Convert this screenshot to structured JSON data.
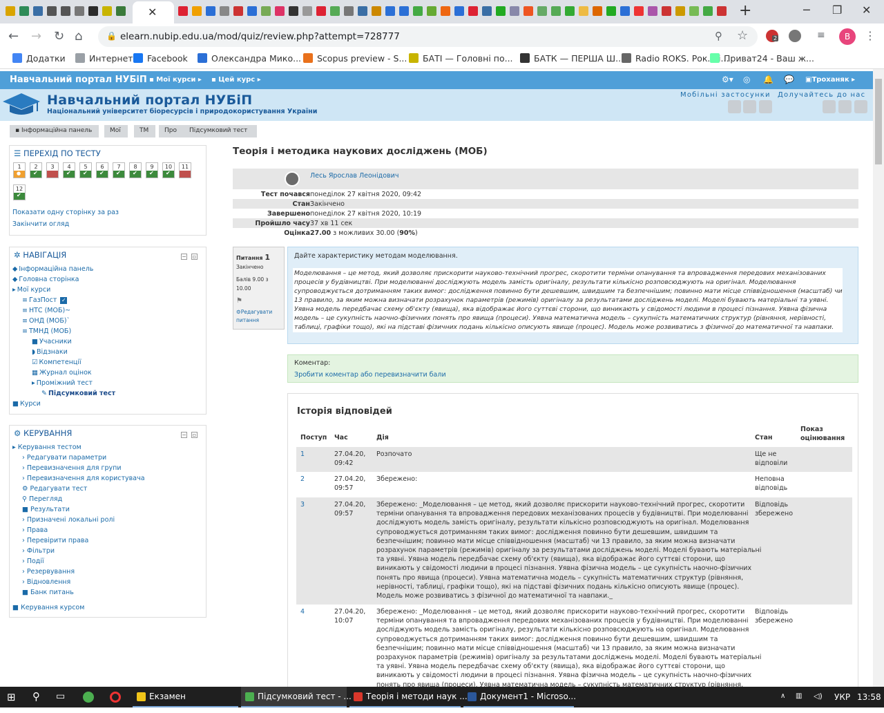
{
  "browser": {
    "url": "elearn.nubip.edu.ua/mod/quiz/review.php?attempt=728777",
    "bookmarks": [
      "Додатки",
      "Интернет",
      "Facebook",
      "Олександра Мико...",
      "Scopus preview - S...",
      "БАТІ — Головні по...",
      "БАТК — ПЕРША Ш...",
      "Radio ROKS. Рок. Ті...",
      "Приват24 - Ваш ж..."
    ],
    "profile_initial": "B",
    "badge": "2"
  },
  "site": {
    "brand": "Навчальний портал НУБіП",
    "my_courses": "Мої курси",
    "this_course": "Цей курс",
    "user": "Троханяк",
    "title": "Навчальний портал НУБіП",
    "subtitle": "Національний університет біоресурсів і природокористування України",
    "mobile_apps": "Мобільні застосунки",
    "join_us": "Долучайтесь до нас"
  },
  "breadcrumb": [
    "Інформаційна панель",
    "Мої",
    "ТМ",
    "Про",
    "Підсумковий тест"
  ],
  "quiz_nav": {
    "title": "ПЕРЕХІД ПО ТЕСТУ",
    "questions": [
      {
        "n": "1",
        "state": "flag"
      },
      {
        "n": "2",
        "state": "ok"
      },
      {
        "n": "3",
        "state": "bad"
      },
      {
        "n": "4",
        "state": "ok"
      },
      {
        "n": "5",
        "state": "ok"
      },
      {
        "n": "6",
        "state": "ok"
      },
      {
        "n": "7",
        "state": "ok"
      },
      {
        "n": "8",
        "state": "ok"
      },
      {
        "n": "9",
        "state": "ok"
      },
      {
        "n": "10",
        "state": "ok"
      },
      {
        "n": "11",
        "state": "bad"
      },
      {
        "n": "12",
        "state": "ok"
      }
    ],
    "show_one_page": "Показати одну сторінку за раз",
    "finish_review": "Закінчити огляд"
  },
  "navigation": {
    "title": "НАВІГАЦІЯ",
    "items": [
      "Інформаційна панель",
      "Головна сторінка",
      "Мої курси",
      "ГазПост",
      "НТС (МОБ)~",
      "ОНД (МОБ)`",
      "ТМНД (МОБ)",
      "Учасники",
      "Відзнаки",
      "Компетенції",
      "Журнал оцінок",
      "Проміжний тест",
      "Підсумковий тест",
      "Курси"
    ]
  },
  "admin": {
    "title": "КЕРУВАННЯ",
    "items": [
      "Керування тестом",
      "Редагувати параметри",
      "Перевизначення для групи",
      "Перевизначення для користувача",
      "Редагувати тест",
      "Перегляд",
      "Результати",
      "Призначені локальні ролі",
      "Права",
      "Перевірити права",
      "Фільтри",
      "Події",
      "Резервування",
      "Відновлення",
      "Банк питань",
      "Керування курсом"
    ]
  },
  "quiz": {
    "title": "Теорія і методика наукових досліджень (МОБ)",
    "student": "Лесь Ярослав Леонідович",
    "summary": [
      {
        "k": "Тест почався",
        "v": "понеділок 27 квітня 2020, 09:42"
      },
      {
        "k": "Стан",
        "v": "Закінчено"
      },
      {
        "k": "Завершено",
        "v": "понеділок 27 квітня 2020, 10:19"
      },
      {
        "k": "Пройшло часу",
        "v": "37 хв 11 сек"
      },
      {
        "k": "Оцінка",
        "v_bold": "27.00",
        "v_mid": " з можливих 30.00 (",
        "v_pct": "90%",
        "v_end": ")"
      }
    ]
  },
  "question": {
    "label": "Питання",
    "number": "1",
    "state": "Закінчено",
    "marks": "Балів 9.00 з 10.00",
    "edit": "Редагувати питання",
    "prompt": "Дайте характеристику методам моделювання.",
    "answer_lines": [
      "Моделювання – це метод, який дозволяє прискорити науково-технічний прогрес, скоротити терміни опанування та впровадження передових механізованих",
      "процесів у будівництві. При моделюванні досліджують модель замість оригіналу, результати кількісно розповсюджують на оригінал. Моделювання",
      "супроводжується дотриманням таких вимог: дослідження повинно бути дешевшим, швидшим та безпечнішим; повинно мати місце співвідношення (масштаб) чи",
      "13 правило, за яким можна визначати розрахунок параметрів (режимів) оригіналу за результатами досліджень моделі. Моделі бувають матеріальні та уявні.",
      "Уявна модель передбачає схему об'єкту (явища), яка відображає його суттєві сторони, що виникають у свідомості людини в процесі пізнання. Уявна фізична",
      "модель – це сукупність наочно-фізичних понять про явища (процеси). Уявна математична модель – сукупність математичних структур (рівняння, нерівності,",
      "таблиці, графіки тощо), які на підставі фізичних подань кількісно описують явище (процес). Модель може розвиватись з фізичної до математичної та навпаки."
    ],
    "comment_label": "Коментар:",
    "comment_link": "Зробити коментар або перевизначити бали"
  },
  "history": {
    "title": "Історія відповідей",
    "headers": [
      "Поступ",
      "Час",
      "Дія",
      "Стан",
      "Показ оцінювання"
    ],
    "rows": [
      {
        "step": "1",
        "date": "27.04.20,",
        "time": "09:42",
        "action": [
          "Розпочато"
        ],
        "state": [
          "Ще не",
          "відповіли"
        ]
      },
      {
        "step": "2",
        "date": "27.04.20,",
        "time": "09:57",
        "action": [
          "Збережено:"
        ],
        "state": [
          "Неповна",
          "відповідь"
        ]
      },
      {
        "step": "3",
        "date": "27.04.20,",
        "time": "09:57",
        "action": [
          "Збережено: _Моделювання – це метод, який дозволяє прискорити науково-технічний прогрес, скоротити",
          "терміни опанування та впровадження передових механізованих процесів у будівництві. При моделюванні",
          "досліджують модель замість оригіналу, результати кількісно розповсюджують на оригінал. Моделювання",
          "супроводжується дотриманням таких вимог: дослідження повинно бути дешевшим, швидшим та",
          "безпечнішим; повинно мати місце співвідношення (масштаб) чи 13 правило, за яким можна визначати",
          "розрахунок параметрів (режимів) оригіналу за результатами досліджень моделі. Моделі бувають матеріальні",
          "та уявні. Уявна модель передбачає схему об'єкту (явища), яка відображає його суттєві сторони, що",
          "виникають у свідомості людини в процесі пізнання. Уявна фізична модель – це сукупність наочно-фізичних",
          "понять про явища (процеси). Уявна математична модель – сукупність математичних структур (рівняння,",
          "нерівності, таблиці, графіки тощо), які на підставі фізичних подань кількісно описують явище (процес).",
          "Модель може розвиватись з фізичної до математичної та навпаки._"
        ],
        "state": [
          "Відповідь",
          "збережено"
        ]
      },
      {
        "step": "4",
        "date": "27.04.20,",
        "time": "10:07",
        "action": [
          "Збережено: _Моделювання – це метод, який дозволяє прискорити науково-технічний прогрес, скоротити",
          "терміни опанування та впровадження передових механізованих процесів у будівництві. При моделюванні",
          "досліджують модель замість оригіналу, результати кількісно розповсюджують на оригінал. Моделювання",
          "супроводжується дотриманням таких вимог: дослідження повинно бути дешевшим, швидшим та",
          "безпечнішим; повинно мати місце співвідношення (масштаб) чи 13 правило, за яким можна визначати",
          "розрахунок параметрів (режимів) оригіналу за результатами досліджень моделі. Моделі бувають матеріальні",
          "та уявні. Уявна модель передбачає схему об'єкту (явища), яка відображає його суттєві сторони, що",
          "виникають у свідомості людини в процесі пізнання. Уявна фізична модель – це сукупність наочно-фізичних",
          "понять про явища (процеси). Уявна математична модель – сукупність математичних структур (рівняння,"
        ],
        "state": [
          "Відповідь",
          "збережено"
        ]
      }
    ]
  },
  "taskbar": {
    "items": [
      "Екзамен",
      "Підсумковий тест - ...",
      "Теорія і методи наук ...",
      "Документ1 - Microso..."
    ],
    "lang": "УКР",
    "time": "13:58"
  },
  "chart_data": {
    "type": "table",
    "columns": [
      "Поступ",
      "Час",
      "Дія",
      "Стан"
    ],
    "rows": [
      [
        "1",
        "27.04.20, 09:42",
        "Розпочато",
        "Ще не відповіли"
      ],
      [
        "2",
        "27.04.20, 09:57",
        "Збережено:",
        "Неповна відповідь"
      ],
      [
        "3",
        "27.04.20, 09:57",
        "Збережено: _Моделювання – це метод...",
        "Відповідь збережено"
      ],
      [
        "4",
        "27.04.20, 10:07",
        "Збережено: _Моделювання – це метод...",
        "Відповідь збережено"
      ]
    ]
  },
  "colors": {
    "primary": "#4f9fd8",
    "link": "#1a6aa8",
    "ok": "#3c8a3c",
    "bad": "#c0504d",
    "flag": "#f0a030"
  }
}
